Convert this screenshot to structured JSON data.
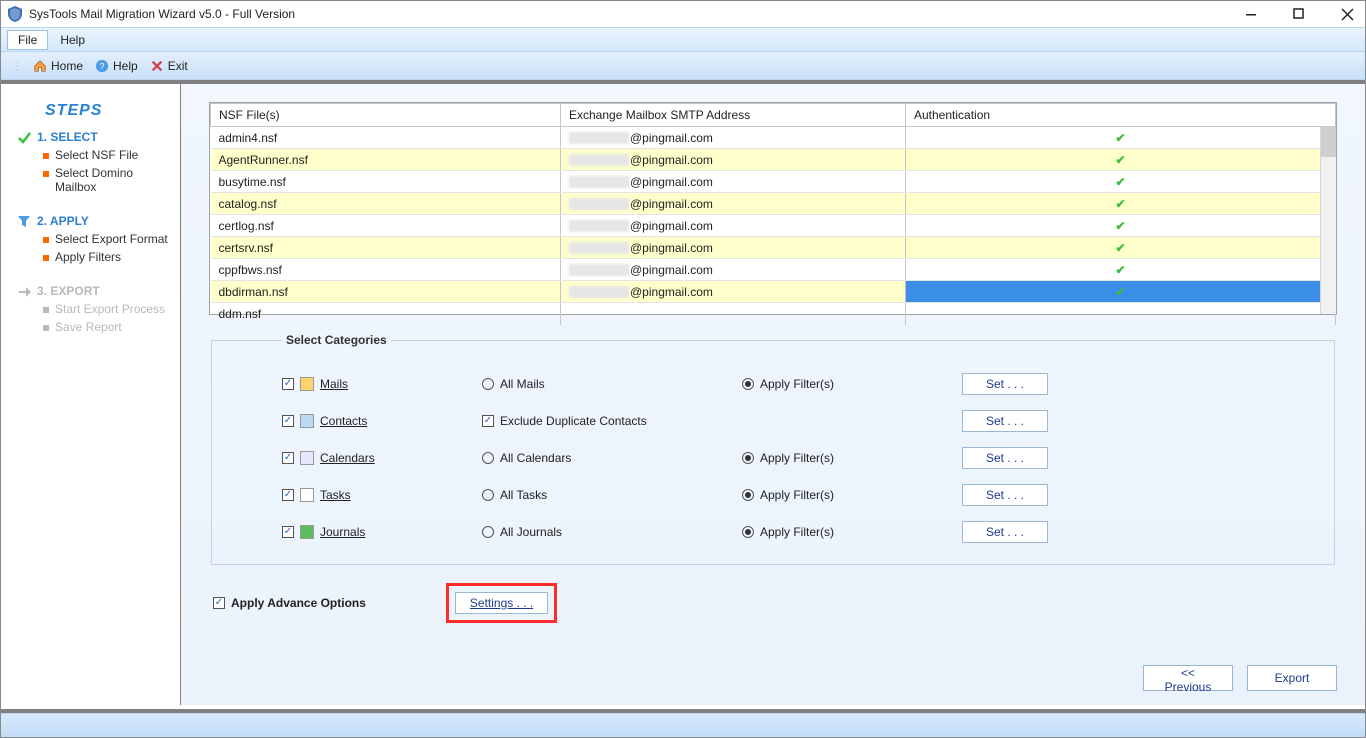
{
  "window": {
    "title": "SysTools Mail Migration Wizard v5.0 - Full Version"
  },
  "menu": {
    "file": "File",
    "help": "Help"
  },
  "toolbar": {
    "home": "Home",
    "help": "Help",
    "exit": "Exit"
  },
  "steps": {
    "heading": "STEPS",
    "s1": {
      "title": "1. SELECT",
      "items": [
        "Select NSF File",
        "Select Domino Mailbox"
      ]
    },
    "s2": {
      "title": "2. APPLY",
      "items": [
        "Select Export Format",
        "Apply Filters"
      ]
    },
    "s3": {
      "title": "3. EXPORT",
      "items": [
        "Start Export Process",
        "Save Report"
      ]
    }
  },
  "table": {
    "headers": {
      "nsf": "NSF File(s)",
      "addr": "Exchange Mailbox SMTP Address",
      "auth": "Authentication"
    },
    "domain": "@pingmail.com",
    "rows": [
      {
        "nsf": "admin4.nsf"
      },
      {
        "nsf": "AgentRunner.nsf"
      },
      {
        "nsf": "busytime.nsf"
      },
      {
        "nsf": "catalog.nsf"
      },
      {
        "nsf": "certlog.nsf"
      },
      {
        "nsf": "certsrv.nsf"
      },
      {
        "nsf": "cppfbws.nsf"
      },
      {
        "nsf": "dbdirman.nsf"
      },
      {
        "nsf": "ddm.nsf"
      }
    ]
  },
  "categories": {
    "legend": "Select Categories",
    "mails": {
      "label": "Mails",
      "opt_all": "All Mails",
      "opt_filter": "Apply Filter(s)",
      "set": "Set . . ."
    },
    "contacts": {
      "label": "Contacts",
      "opt_excl": "Exclude Duplicate Contacts",
      "set": "Set . . ."
    },
    "calendars": {
      "label": "Calendars",
      "opt_all": "All Calendars",
      "opt_filter": "Apply Filter(s)",
      "set": "Set . . ."
    },
    "tasks": {
      "label": "Tasks",
      "opt_all": "All Tasks",
      "opt_filter": "Apply Filter(s)",
      "set": "Set . . ."
    },
    "journals": {
      "label": "Journals",
      "opt_all": "All Journals",
      "opt_filter": "Apply Filter(s)",
      "set": "Set . . ."
    }
  },
  "advance": {
    "label": "Apply Advance Options",
    "settings": "Settings . . ."
  },
  "nav": {
    "prev": "<< Previous",
    "export": "Export"
  }
}
